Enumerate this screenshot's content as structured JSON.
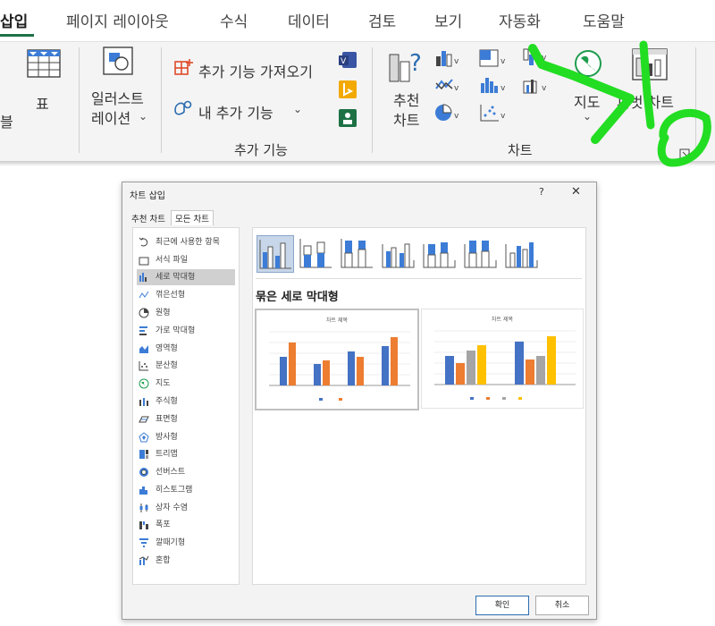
{
  "ribbon": {
    "tabs": [
      "삽입",
      "페이지 레이아웃",
      "수식",
      "데이터",
      "검토",
      "보기",
      "자동화",
      "도움말"
    ],
    "table_label": "표",
    "table_left_label": "블",
    "illustration_line1": "일러스트",
    "illustration_line2": "레이션",
    "addins_get": "추가 기능 가져오기",
    "addins_my": "내 추가 기능",
    "addins_group": "추가 기능",
    "recommended_line1": "추천",
    "recommended_line2": "차트",
    "charts_group": "차트",
    "map_label": "지도",
    "pivot_label": "피벗 차트"
  },
  "dialog": {
    "title": "차트 삽입",
    "help": "?",
    "close": "✕",
    "tabs": [
      "추천 차트",
      "모든 차트"
    ],
    "categories": [
      "최근에 사용한 항목",
      "서식 파일",
      "세로 막대형",
      "꺾은선형",
      "원형",
      "가로 막대형",
      "영역형",
      "분산형",
      "지도",
      "주식형",
      "표면형",
      "방사형",
      "트리맵",
      "선버스트",
      "히스토그램",
      "상자 수염",
      "폭포",
      "깔때기형",
      "혼합"
    ],
    "selected_category": "세로 막대형",
    "section_title": "묶은 세로 막대형",
    "preview_title": "차트 제목",
    "ok": "확인",
    "cancel": "취소"
  },
  "colors": {
    "accent": "#1e7145",
    "annotation": "#22dd22",
    "series_blue": "#4472c4",
    "series_orange": "#ed7d31",
    "series_gray": "#a5a5a5",
    "series_yellow": "#ffc000"
  }
}
